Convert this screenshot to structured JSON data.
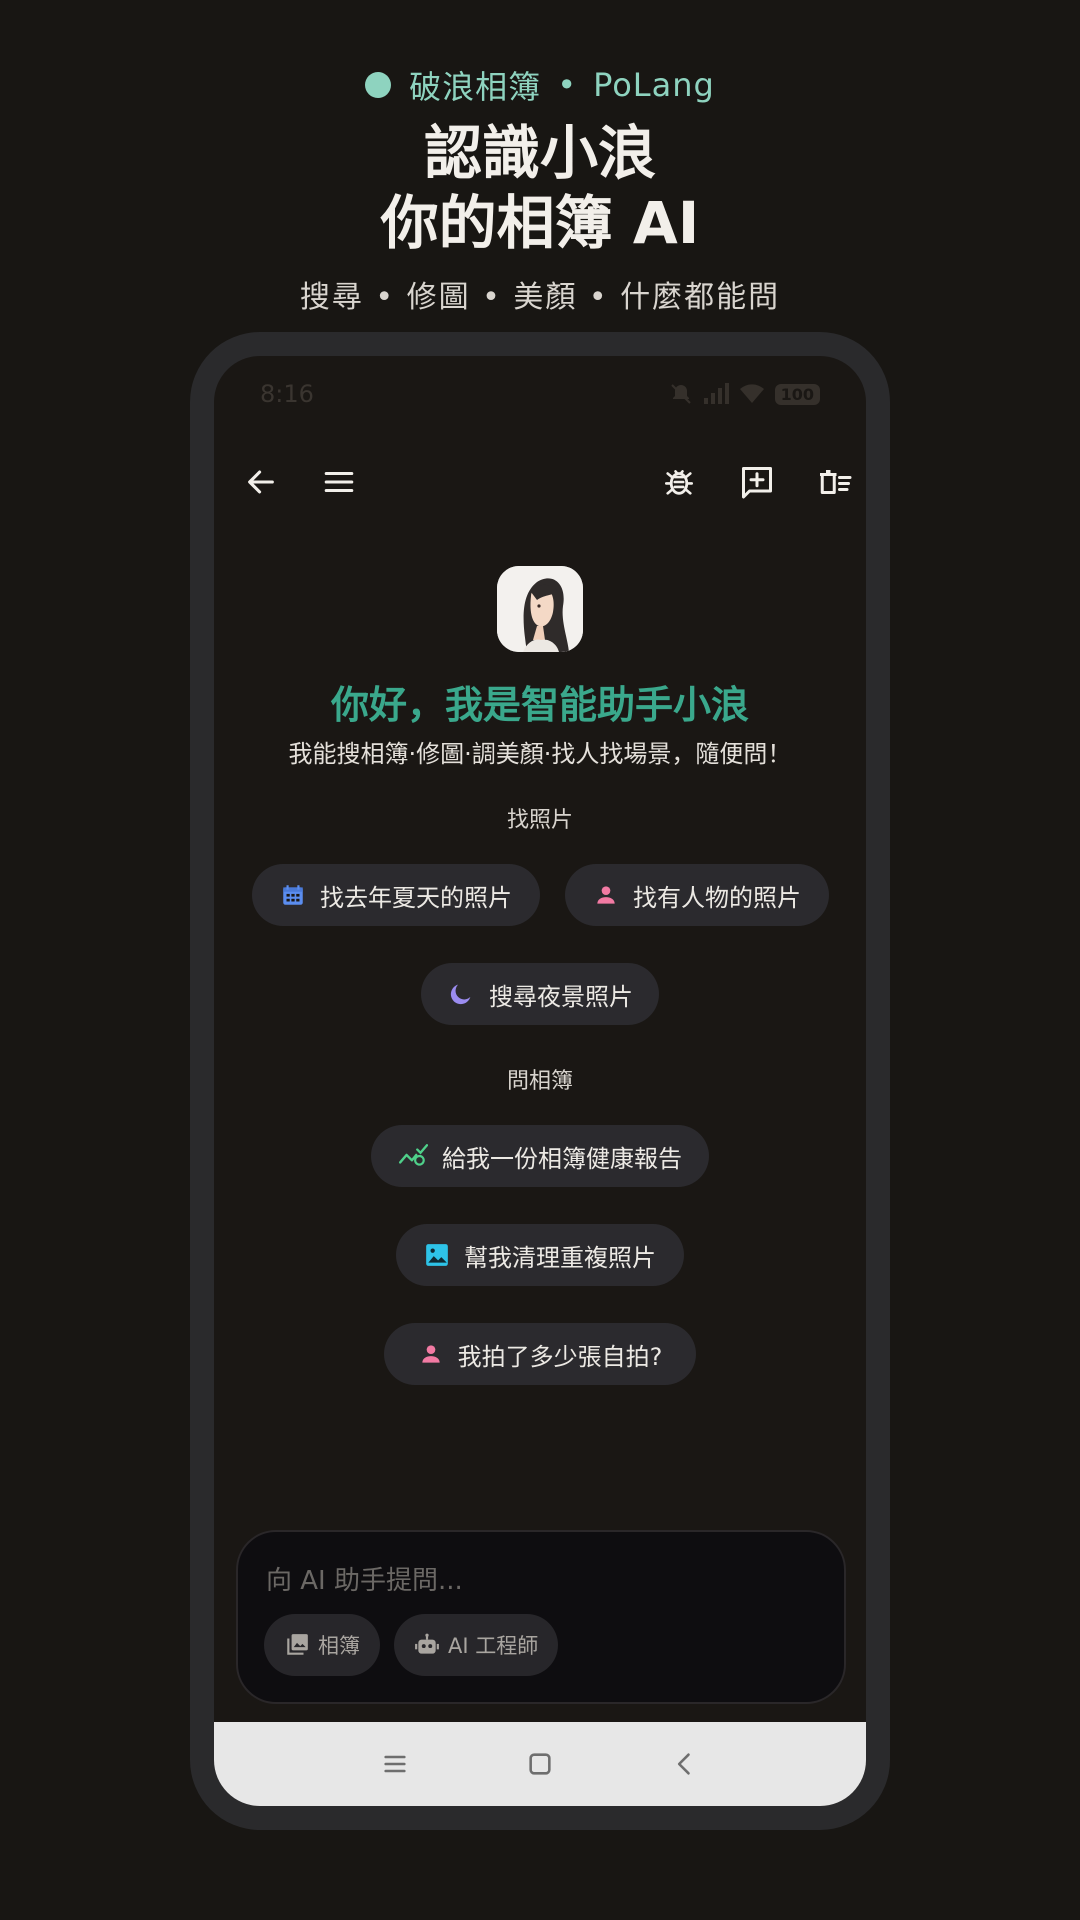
{
  "promo": {
    "brand_cn": "破浪相簿",
    "brand_sep": "•",
    "brand_en": "PoLang",
    "title_line1": "認識小浪",
    "title_line2": "你的相簿 AI",
    "subtitle": "搜尋 • 修圖 • 美顏 • 什麼都能問"
  },
  "status_bar": {
    "time": "8:16",
    "battery": "100"
  },
  "toolbar": {
    "back_icon": "arrow-left-icon",
    "menu_icon": "hamburger-menu-icon",
    "debug_icon": "bug-icon",
    "new_chat_icon": "add-comment-icon",
    "clear_icon": "delete-sweep-icon"
  },
  "chat": {
    "greeting": "你好，我是智能助手小浪",
    "tagline": "我能搜相簿·修圖·調美顏·找人找場景，隨便問！",
    "sections": {
      "find_photos": {
        "label": "找照片",
        "chips": [
          {
            "label": "找去年夏天的照片",
            "icon": "calendar-icon",
            "color": "#5b8def"
          },
          {
            "label": "找有人物的照片",
            "icon": "person-icon",
            "color": "#f27aa3"
          },
          {
            "label": "搜尋夜景照片",
            "icon": "moon-icon",
            "color": "#9b8cf0"
          }
        ]
      },
      "ask_album": {
        "label": "問相簿",
        "chips": [
          {
            "label": "給我一份相簿健康報告",
            "icon": "chart-check-icon",
            "color": "#4fd08a"
          },
          {
            "label": "幫我清理重複照片",
            "icon": "image-icon",
            "color": "#2ec3e8"
          },
          {
            "label": "我拍了多少張自拍?",
            "icon": "person-icon",
            "color": "#f27aa3"
          }
        ]
      }
    }
  },
  "input": {
    "placeholder": "向 AI 助手提問...",
    "album_button": "相簿",
    "engineer_button": "AI 工程師"
  },
  "nav": {
    "recents": "menu-icon",
    "home": "square-icon",
    "back": "chevron-left-icon"
  },
  "colors": {
    "accent": "#8ed3bf",
    "greeting": "#3aa88c",
    "background": "#181613"
  }
}
